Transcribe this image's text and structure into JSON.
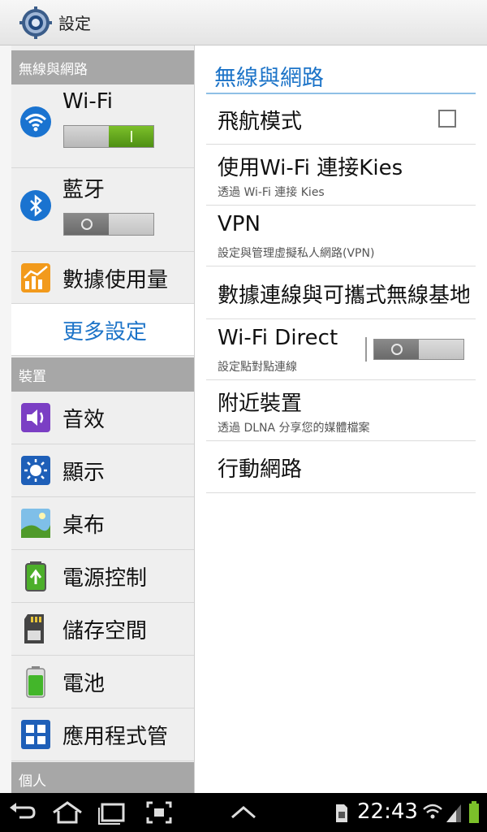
{
  "app": {
    "title": "設定",
    "icon": "settings-gear-icon"
  },
  "left_panel": {
    "sections": [
      {
        "label": "無線與網路"
      },
      {
        "label": "裝置"
      },
      {
        "label": "個人"
      }
    ],
    "items": [
      {
        "label": "Wi-Fi",
        "icon": "wifi-icon",
        "toggle": "on"
      },
      {
        "label": "藍牙",
        "icon": "bluetooth-icon",
        "toggle": "off"
      },
      {
        "label": "數據使用量",
        "icon": "data-usage-icon"
      },
      {
        "label": "更多設定",
        "selected": true
      },
      {
        "label": "音效",
        "icon": "sound-icon"
      },
      {
        "label": "顯示",
        "icon": "display-icon"
      },
      {
        "label": "桌布",
        "icon": "wallpaper-icon"
      },
      {
        "label": "電源控制",
        "icon": "power-saving-icon"
      },
      {
        "label": "儲存空間",
        "icon": "storage-icon"
      },
      {
        "label": "電池",
        "icon": "battery-icon"
      },
      {
        "label": "應用程式管",
        "icon": "apps-icon"
      }
    ]
  },
  "right_panel": {
    "title": "無線與網路",
    "items": [
      {
        "title": "飛航模式",
        "control": "checkbox",
        "checked": false
      },
      {
        "title": "使用Wi-Fi 連接Kies",
        "subtitle": "透過 Wi-Fi 連接 Kies"
      },
      {
        "title": "VPN",
        "subtitle": "設定與管理虛擬私人網路(VPN)"
      },
      {
        "title": "數據連線與可攜式無線基地台"
      },
      {
        "title": "Wi-Fi Direct",
        "subtitle": "設定點對點連線",
        "control": "toggle",
        "toggle": "off"
      },
      {
        "title": "附近裝置",
        "subtitle": "透過 DLNA 分享您的媒體檔案"
      },
      {
        "title": "行動網路"
      }
    ]
  },
  "status_bar": {
    "time": "22:43",
    "icons": [
      "back-icon",
      "home-icon",
      "recent-apps-icon",
      "screenshot-icon",
      "menu-up-icon",
      "sim-card-icon",
      "wifi-signal-icon",
      "cell-signal-icon",
      "battery-icon"
    ]
  },
  "colors": {
    "accent": "#1d74c8",
    "toggle_on": "#5fa31c",
    "section_bg": "#a7a7a7"
  }
}
